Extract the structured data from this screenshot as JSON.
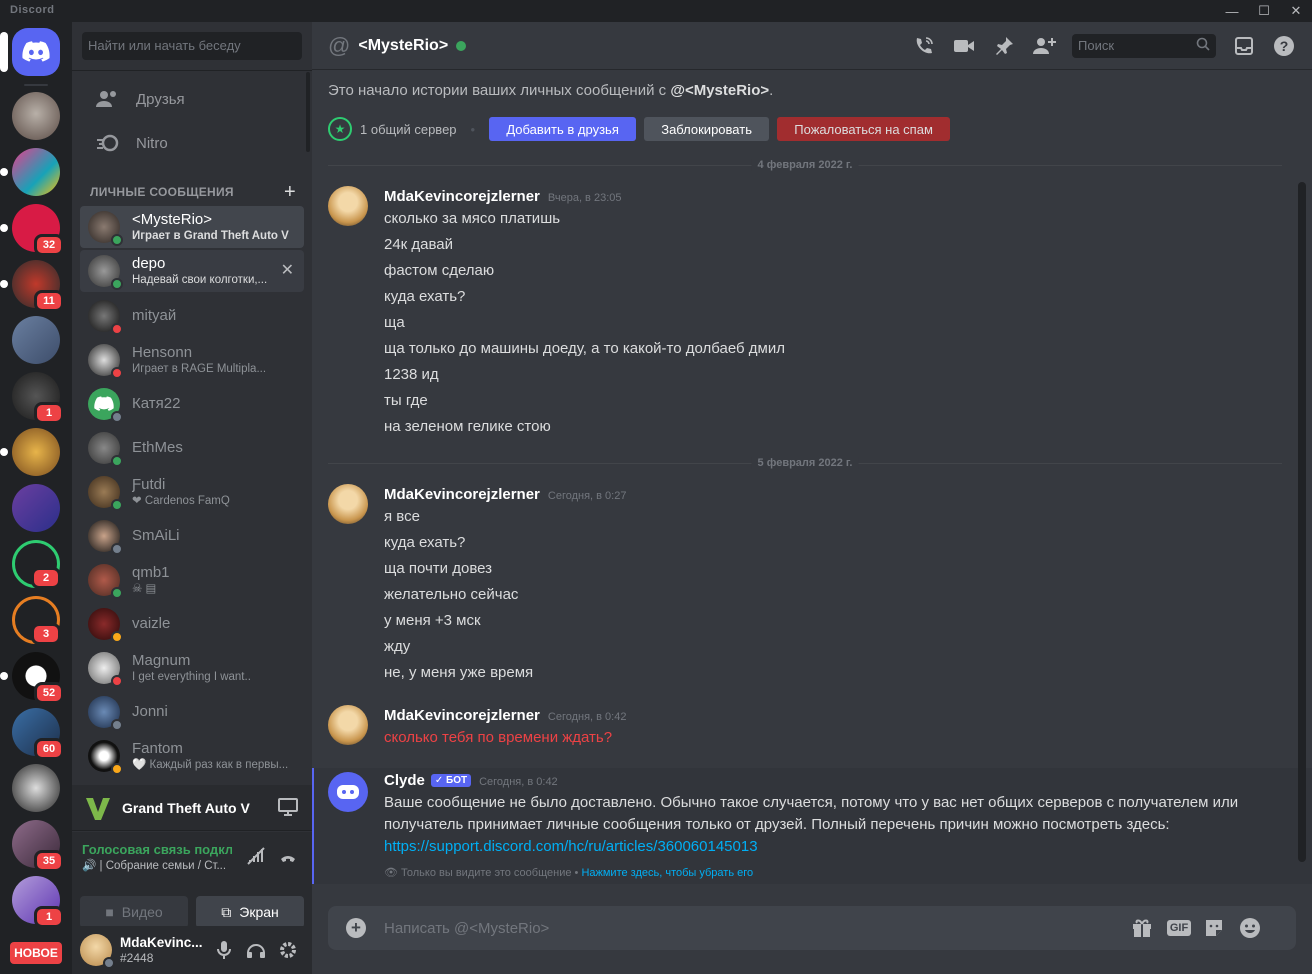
{
  "app": {
    "title": "Discord"
  },
  "window": {
    "minimize": "—",
    "maximize": "☐",
    "close": "✕"
  },
  "guilds": [
    {
      "name": "home",
      "badge": ""
    },
    {
      "name": "server-1",
      "badge": ""
    },
    {
      "name": "server-24-7",
      "badge": ""
    },
    {
      "name": "server-blood",
      "badge": "32"
    },
    {
      "name": "server-family",
      "badge": "11"
    },
    {
      "name": "server-5",
      "badge": ""
    },
    {
      "name": "server-6",
      "badge": "1"
    },
    {
      "name": "server-7",
      "badge": ""
    },
    {
      "name": "server-8",
      "badge": ""
    },
    {
      "name": "server-9",
      "badge": "2"
    },
    {
      "name": "server-10",
      "badge": "3"
    },
    {
      "name": "server-11",
      "badge": "52"
    },
    {
      "name": "server-guides",
      "badge": "60"
    },
    {
      "name": "server-raccoon",
      "badge": ""
    },
    {
      "name": "server-14",
      "badge": "35"
    },
    {
      "name": "server-15",
      "badge": "1"
    }
  ],
  "new_tag": "НОВОЕ",
  "sidebar": {
    "search_placeholder": "Найти или начать беседу",
    "friends": "Друзья",
    "nitro": "Nitro",
    "dm_header": "ЛИЧНЫЕ СООБЩЕНИЯ",
    "dm_add": "+",
    "dms": [
      {
        "name": "<MysteRio>",
        "sub": "Играет в Grand Theft Auto V",
        "status": "on"
      },
      {
        "name": "depo",
        "sub": "Надевай свои колготки,...",
        "status": "on"
      },
      {
        "name": "mityaй",
        "sub": "",
        "status": "dnd"
      },
      {
        "name": "Hensonn",
        "sub": "Играет в RAGE Multipla...",
        "status": "dnd"
      },
      {
        "name": "Катя22",
        "sub": "",
        "status": "off"
      },
      {
        "name": "EthMes",
        "sub": "",
        "status": "on"
      },
      {
        "name": "Ƒutdi",
        "sub": "❤ Cardenos FamQ",
        "status": "on"
      },
      {
        "name": "SmAiLi",
        "sub": "",
        "status": "off"
      },
      {
        "name": "qmb1",
        "sub": "",
        "status": "on"
      },
      {
        "name": "vaizle",
        "sub": "",
        "status": "idle"
      },
      {
        "name": "Magnum",
        "sub": "I get everything I want..",
        "status": "dnd"
      },
      {
        "name": "Jonni",
        "sub": "",
        "status": "off"
      },
      {
        "name": "Fantom",
        "sub": "🤍 Каждый раз как в первы...",
        "status": "idle"
      }
    ],
    "activity_game": "Grand Theft Auto V",
    "voice_title": "Голосовая связь подключена",
    "voice_sub": "🔊 | Собрание семьи / Ст...",
    "video_label": "Видео",
    "screen_label": "Экран",
    "user_name": "MdaKevinc...",
    "user_tag": "#2448"
  },
  "header": {
    "title": "<MysteRio>",
    "search_placeholder": "Поиск"
  },
  "intro": {
    "text_prefix": "Это начало истории ваших личных сообщений с ",
    "name": "@<MysteRio>",
    "text_suffix": ".",
    "mutual": "1 общий сервер",
    "add_friend": "Добавить в друзья",
    "block": "Заблокировать",
    "report_spam": "Пожаловаться на спам"
  },
  "dates": {
    "d1": "4 февраля 2022 г.",
    "d2": "5 февраля 2022 г."
  },
  "messages": {
    "g1": {
      "author": "MdaKevincorejzlerner",
      "time": "Вчера, в 23:05",
      "lines": [
        "сколько за мясо платишь",
        "24к давай",
        "фастом сделаю",
        "куда ехать?",
        "ща",
        "ща только до машины доеду, а то какой-то долбаеб дмил",
        "1238 ид",
        "ты где",
        "на зеленом гелике стою"
      ]
    },
    "g2": {
      "author": "MdaKevincorejzlerner",
      "time": "Сегодня, в 0:27",
      "lines": [
        "я все",
        "куда ехать?",
        "ща почти довез",
        "желательно сейчас",
        "у меня  +3 мск",
        "жду",
        "не, у меня уже время"
      ]
    },
    "g3": {
      "author": "MdaKevincorejzlerner",
      "time": "Сегодня, в 0:42",
      "lines": [
        "сколько тебя по времени ждать?"
      ]
    },
    "clyde": {
      "author": "Clyde",
      "badge": "✓ БОТ",
      "time": "Сегодня, в 0:42",
      "line1": "Ваше сообщение не было доставлено. Обычно такое случается, потому что у вас нет общих серверов с получателем или",
      "line2": "получатель принимает личные сообщения только от друзей. Полный перечень причин можно посмотреть здесь:",
      "link": "https://support.discord.com/hc/ru/articles/360060145013",
      "ephemeral": "Только вы видите это сообщение",
      "dismiss": "Нажмите здесь, чтобы убрать его"
    }
  },
  "composer": {
    "placeholder": "Написать @<MysteRio>",
    "gif": "GIF"
  },
  "colors": {
    "blurple": "#5865f2",
    "green": "#3ba55d",
    "red": "#ed4245",
    "link": "#00aff4"
  }
}
